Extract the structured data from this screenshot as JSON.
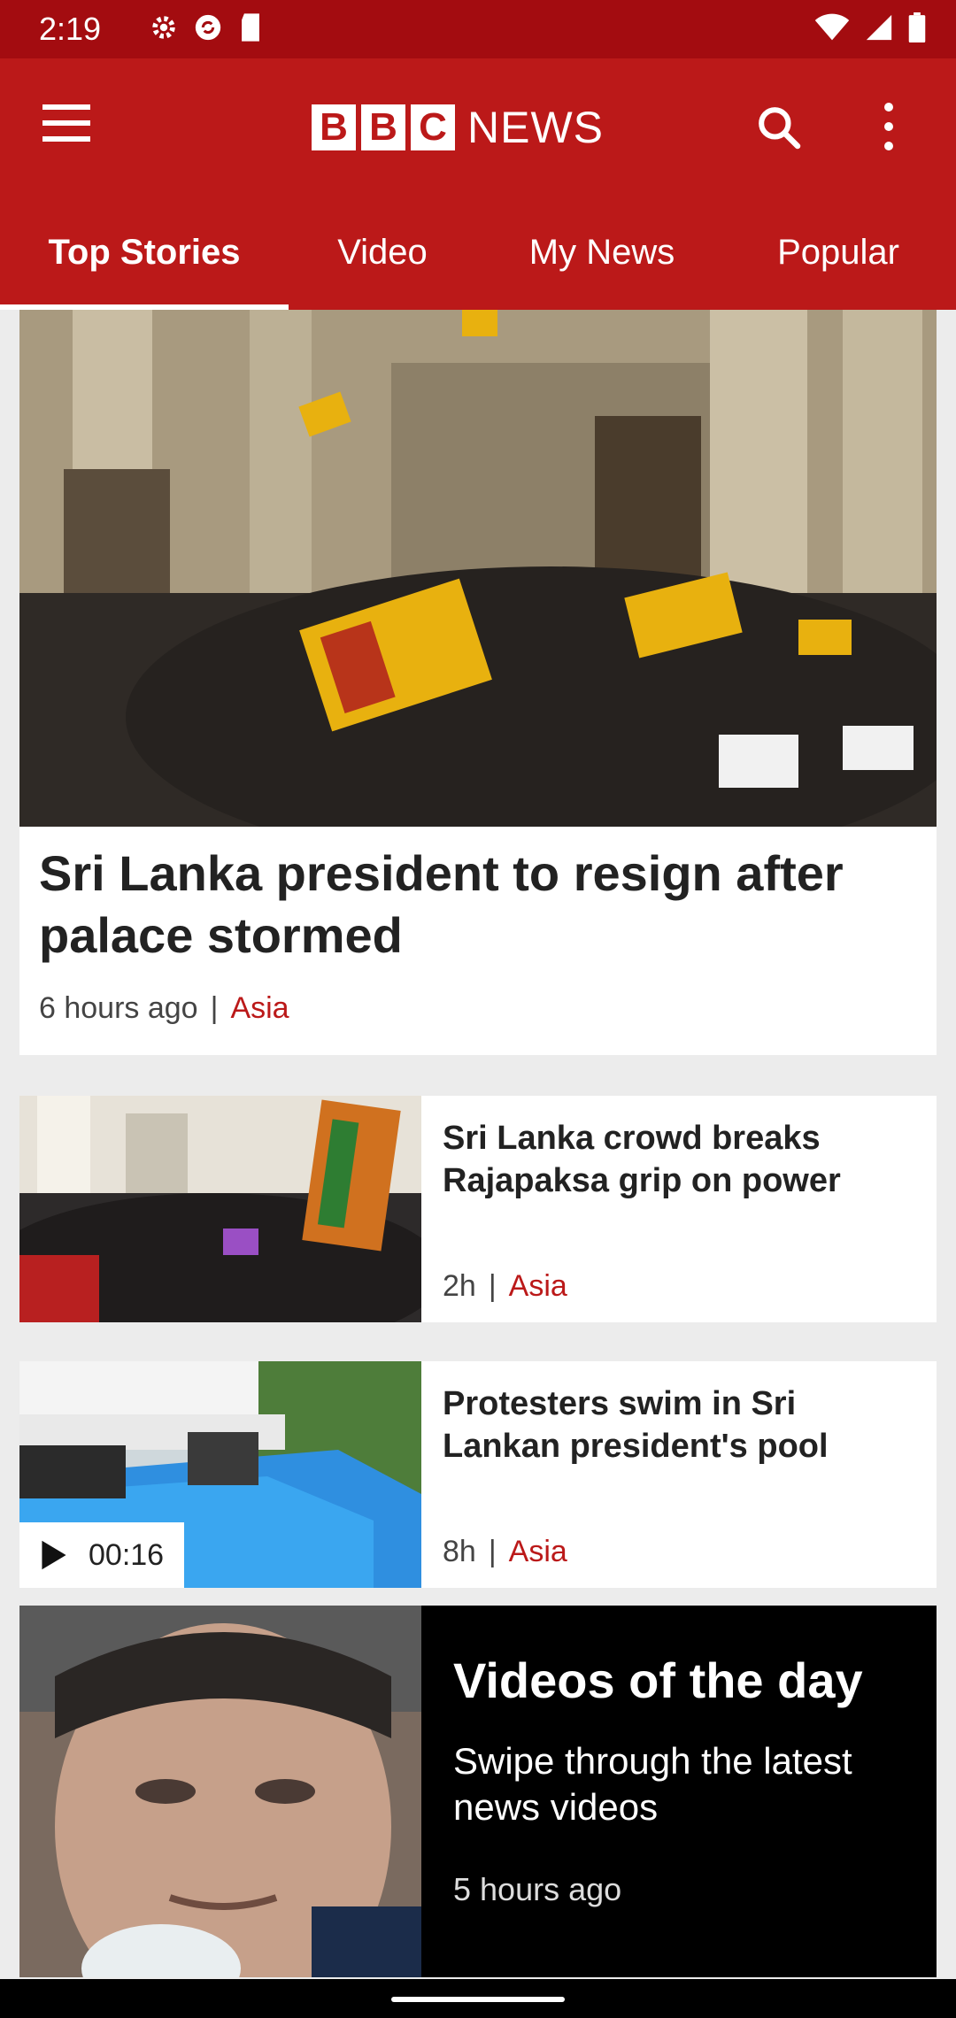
{
  "status_bar": {
    "time": "2:19"
  },
  "header": {
    "logo_letters": [
      "B",
      "B",
      "C"
    ],
    "logo_word": "NEWS",
    "accent": "#bb1919"
  },
  "tabs": [
    {
      "label": "Top Stories",
      "active": true
    },
    {
      "label": "Video",
      "active": false
    },
    {
      "label": "My News",
      "active": false
    },
    {
      "label": "Popular",
      "active": false
    }
  ],
  "hero": {
    "title": "Sri Lanka president to resign after palace stormed",
    "time": "6 hours ago",
    "category": "Asia"
  },
  "stories": [
    {
      "title": "Sri Lanka crowd breaks Rajapaksa grip on power",
      "time": "2h",
      "category": "Asia"
    },
    {
      "title": "Protesters swim in Sri Lankan president's pool",
      "time": "8h",
      "category": "Asia",
      "video_duration": "00:16"
    }
  ],
  "videos_of_day": {
    "title": "Videos of the day",
    "subtitle": "Swipe through the latest news videos",
    "time": "5 hours ago"
  }
}
